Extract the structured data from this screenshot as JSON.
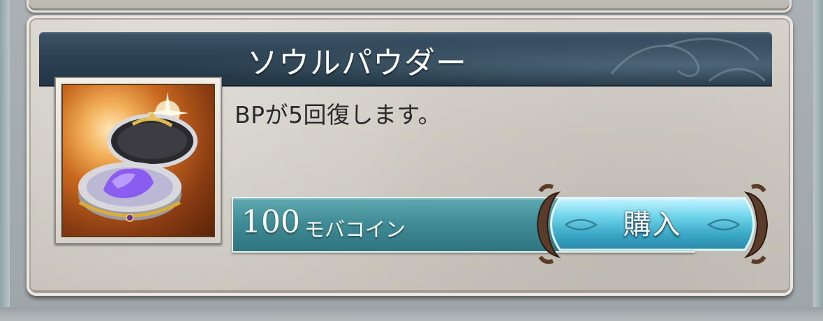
{
  "item": {
    "name": "ソウルパウダー",
    "description": "BPが5回復します。",
    "price_amount": "100",
    "price_currency": "モバコイン",
    "buy_label": "購入",
    "icon": "soul-powder-compact-icon"
  },
  "colors": {
    "title_bar": "#2c4253",
    "price_bar": "#3e8a94",
    "buy_button": "#5fc6dc",
    "card_bg": "#d0ccc3"
  }
}
